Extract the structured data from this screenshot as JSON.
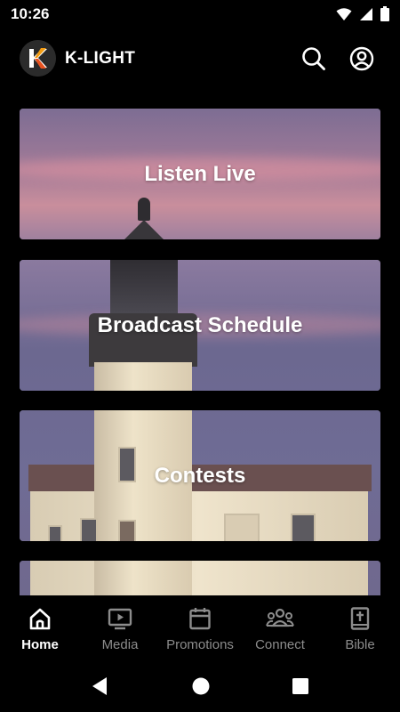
{
  "status_bar": {
    "time": "10:26"
  },
  "app_bar": {
    "title": "K-LIGHT",
    "logo_letter": "K"
  },
  "cards": [
    {
      "label": "Listen Live"
    },
    {
      "label": "Broadcast Schedule"
    },
    {
      "label": "Contests"
    }
  ],
  "bottom_nav": {
    "items": [
      {
        "label": "Home",
        "icon": "home-icon",
        "active": true
      },
      {
        "label": "Media",
        "icon": "media-player-icon",
        "active": false
      },
      {
        "label": "Promotions",
        "icon": "calendar-icon",
        "active": false
      },
      {
        "label": "Connect",
        "icon": "people-group-icon",
        "active": false
      },
      {
        "label": "Bible",
        "icon": "bible-icon",
        "active": false
      }
    ]
  },
  "colors": {
    "background": "#000000",
    "active": "#ffffff",
    "inactive": "#8c8c8c"
  }
}
